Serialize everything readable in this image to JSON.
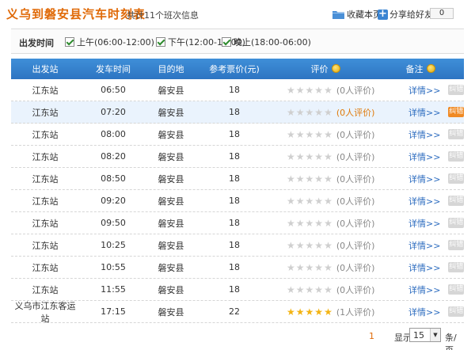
{
  "header": {
    "title": "义乌到磐安县汽车时刻表",
    "subtitle": "共计11个班次信息",
    "favorite_label": "收藏本页",
    "share_label": "分享给好友",
    "share_count": "0"
  },
  "filters": {
    "label": "出发时间",
    "options": [
      {
        "label": "上午(06:00-12:00)",
        "checked": true
      },
      {
        "label": "下午(12:00-18:00)",
        "checked": true
      },
      {
        "label": "晚上(18:00-06:00)",
        "checked": true
      }
    ]
  },
  "table": {
    "headers": {
      "station": "出发站",
      "time": "发车时间",
      "destination": "目的地",
      "price": "参考票价(元)",
      "rating": "评价",
      "note": "备注"
    },
    "rows": [
      {
        "station": "江东站",
        "time": "06:50",
        "destination": "磐安县",
        "price": "18",
        "stars": 0,
        "rating": "(0人评价)",
        "detail": "详情>>",
        "report": "纠错"
      },
      {
        "station": "江东站",
        "time": "07:20",
        "destination": "磐安县",
        "price": "18",
        "stars": 0,
        "rating": "(0人评价)",
        "detail": "详情>>",
        "report": "纠错"
      },
      {
        "station": "江东站",
        "time": "08:00",
        "destination": "磐安县",
        "price": "18",
        "stars": 0,
        "rating": "(0人评价)",
        "detail": "详情>>",
        "report": "纠错"
      },
      {
        "station": "江东站",
        "time": "08:20",
        "destination": "磐安县",
        "price": "18",
        "stars": 0,
        "rating": "(0人评价)",
        "detail": "详情>>",
        "report": "纠错"
      },
      {
        "station": "江东站",
        "time": "08:50",
        "destination": "磐安县",
        "price": "18",
        "stars": 0,
        "rating": "(0人评价)",
        "detail": "详情>>",
        "report": "纠错"
      },
      {
        "station": "江东站",
        "time": "09:20",
        "destination": "磐安县",
        "price": "18",
        "stars": 0,
        "rating": "(0人评价)",
        "detail": "详情>>",
        "report": "纠错"
      },
      {
        "station": "江东站",
        "time": "09:50",
        "destination": "磐安县",
        "price": "18",
        "stars": 0,
        "rating": "(0人评价)",
        "detail": "详情>>",
        "report": "纠错"
      },
      {
        "station": "江东站",
        "time": "10:25",
        "destination": "磐安县",
        "price": "18",
        "stars": 0,
        "rating": "(0人评价)",
        "detail": "详情>>",
        "report": "纠错"
      },
      {
        "station": "江东站",
        "time": "10:55",
        "destination": "磐安县",
        "price": "18",
        "stars": 0,
        "rating": "(0人评价)",
        "detail": "详情>>",
        "report": "纠错"
      },
      {
        "station": "江东站",
        "time": "11:55",
        "destination": "磐安县",
        "price": "18",
        "stars": 0,
        "rating": "(0人评价)",
        "detail": "详情>>",
        "report": "纠错"
      },
      {
        "station": "义乌市江东客运站",
        "time": "17:15",
        "destination": "磐安县",
        "price": "22",
        "stars": 5,
        "rating": "(1人评价)",
        "detail": "详情>>",
        "report": "纠错"
      }
    ]
  },
  "pager": {
    "current_page": "1",
    "show_label": "显示",
    "page_size": "15",
    "unit_label": "条/页"
  },
  "colors": {
    "title": "#e06a08",
    "header_bg": "#3f8fd8",
    "star_on": "#f3b414",
    "star_off": "#cfcfcf",
    "link": "#2b6bbf",
    "report_active": "#f08a24"
  }
}
